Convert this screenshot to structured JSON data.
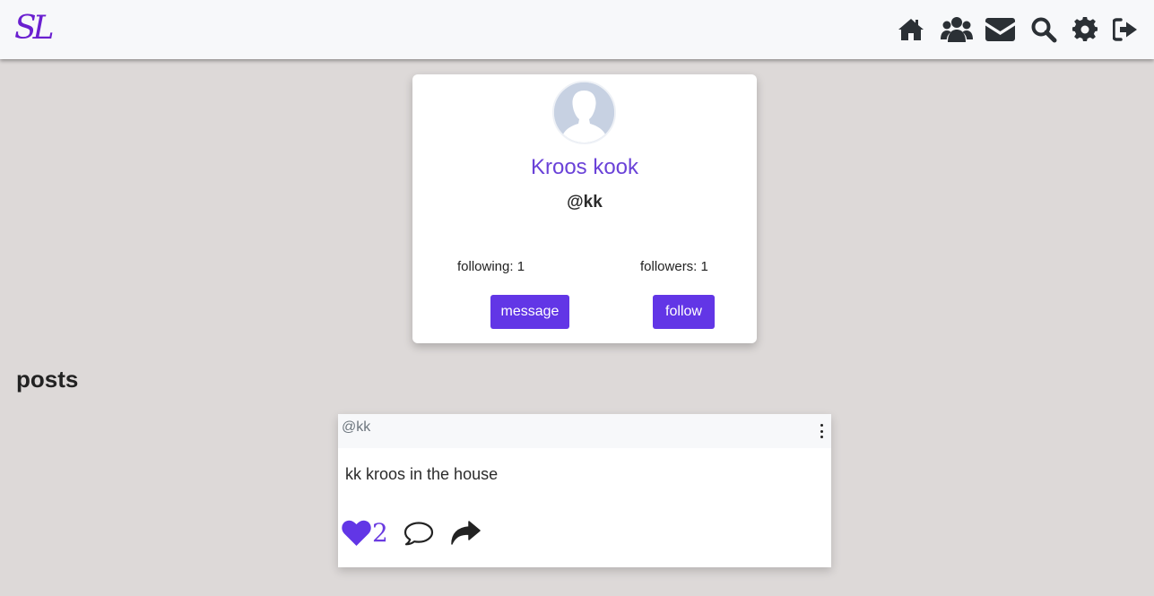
{
  "navbar": {
    "brand": "SL",
    "icons": [
      "home-icon",
      "users-icon",
      "envelope-icon",
      "search-icon",
      "gear-icon",
      "sign-out-icon"
    ]
  },
  "profile": {
    "name": "Kroos kook",
    "handle": "@kk",
    "following_label": "following:",
    "following_count": "1",
    "followers_label": "followers:",
    "followers_count": "1",
    "message_label": "message",
    "follow_label": "follow"
  },
  "posts_section": {
    "title": "posts"
  },
  "posts": [
    {
      "author": "@kk",
      "text": "kk kroos in the house",
      "likes": "2"
    }
  ],
  "colors": {
    "accent": "#6236e6",
    "name": "#6a42d8",
    "page_bg": "#ddd9d8",
    "brand": "#6a1fd0"
  }
}
